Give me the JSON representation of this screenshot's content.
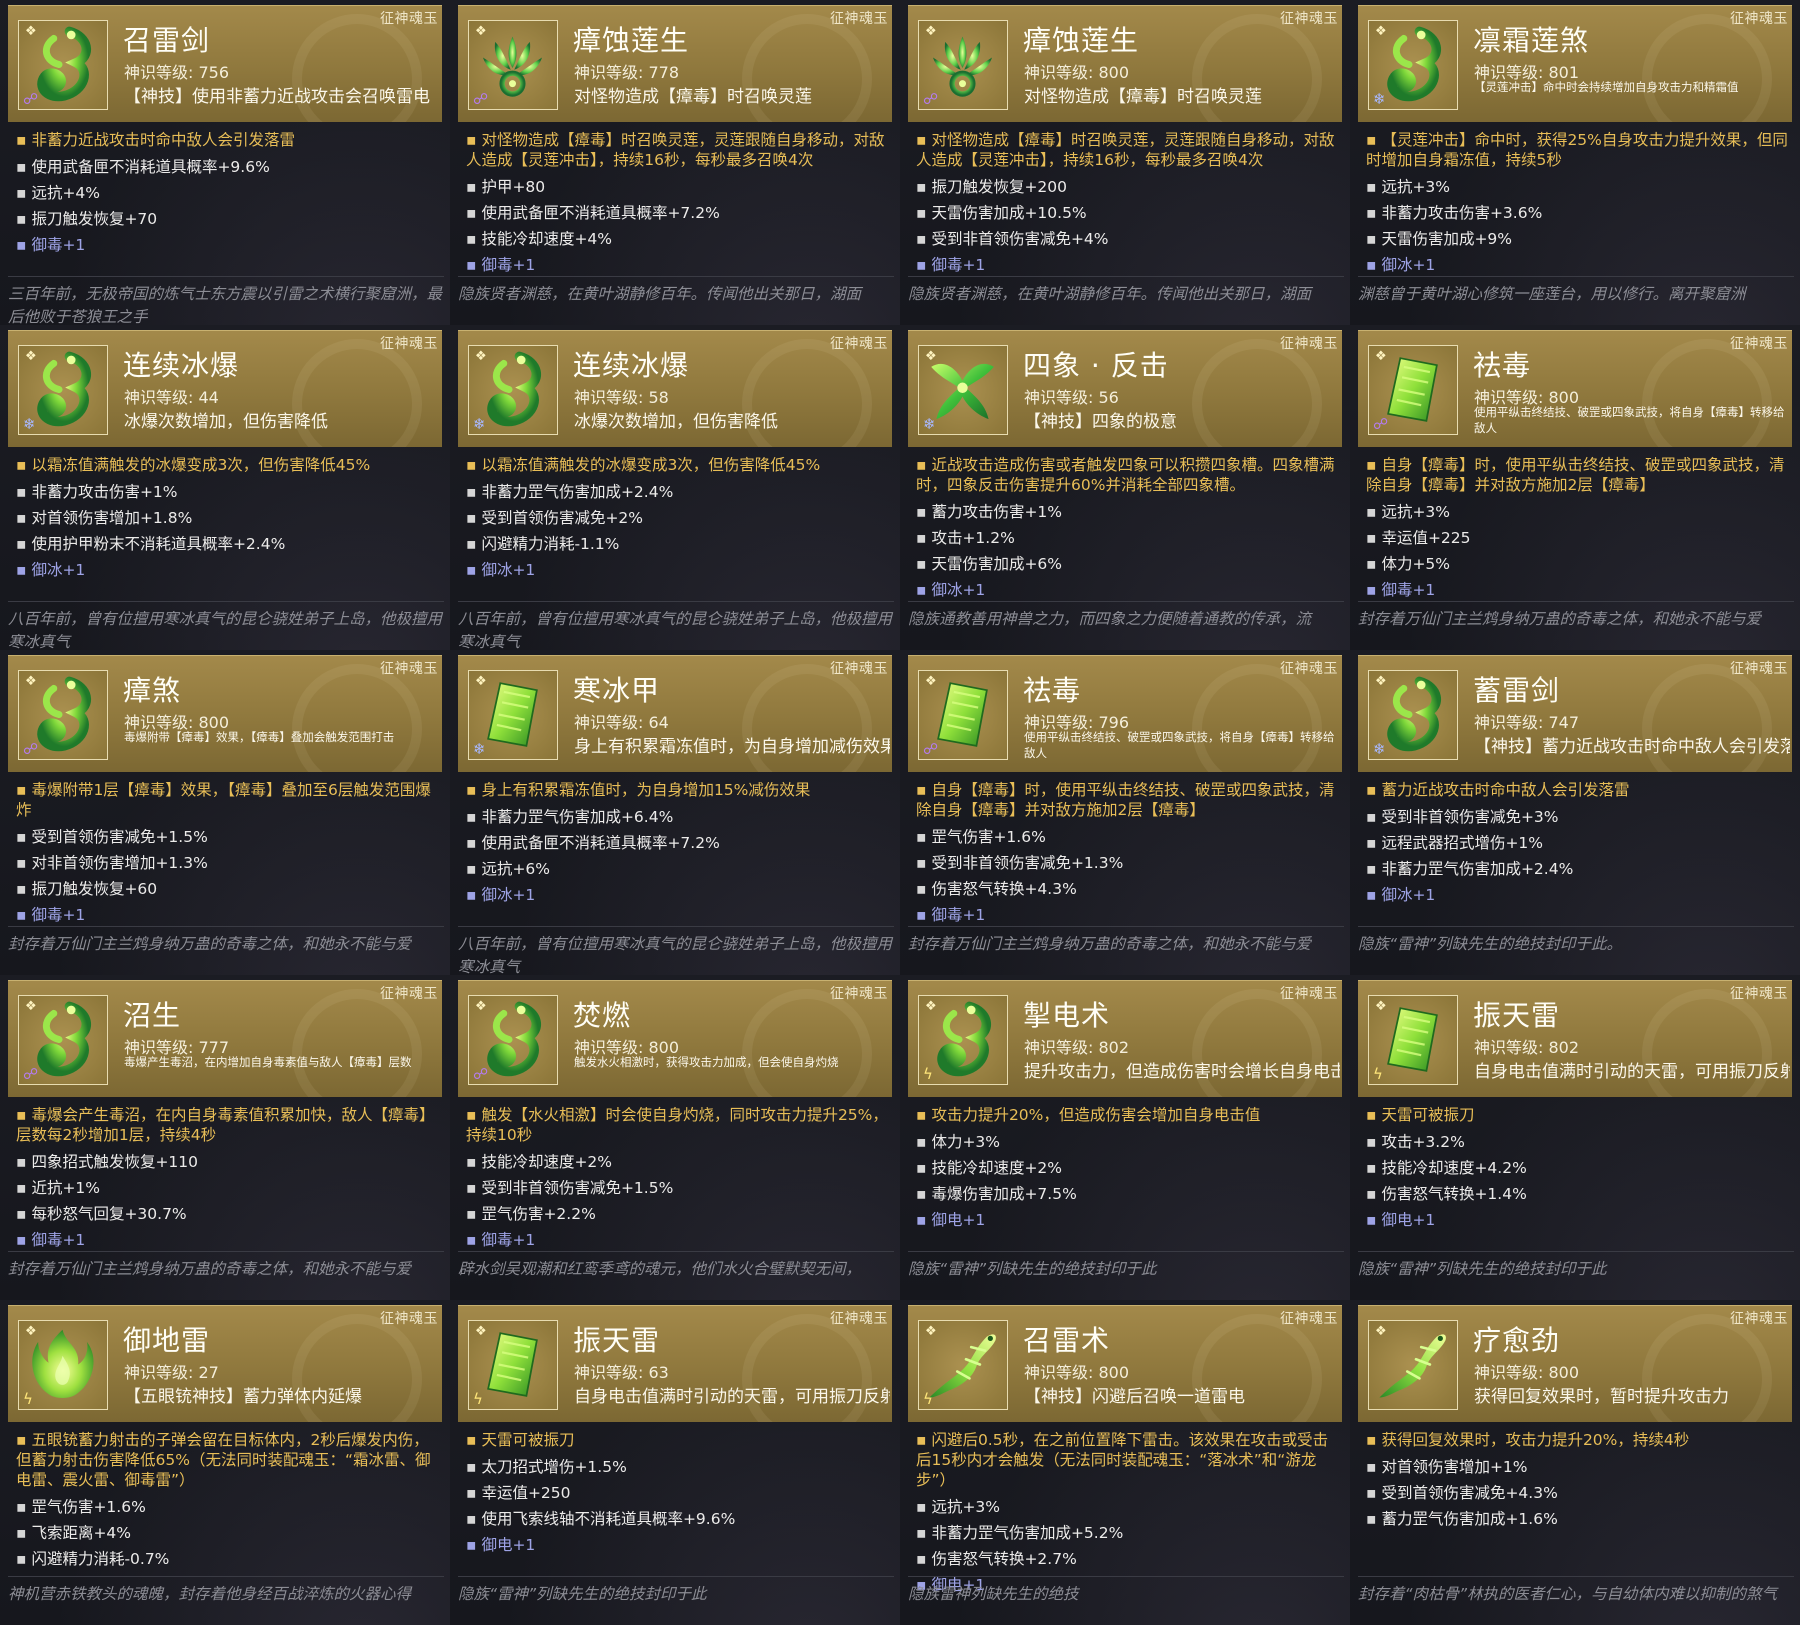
{
  "cards": [
    {
      "tag": "征神魂玉",
      "title": "召雷剑",
      "level": "神识等级: 756",
      "desc": "【神技】使用非蓄力近战攻击会召唤雷电",
      "desc_small": false,
      "icon": "serpent-jade-icon",
      "elem": "poison-icon",
      "effect": "非蓄力近战攻击时命中敌人会引发落雷",
      "stats": [
        "使用武备匣不消耗道具概率+9.6%",
        "远抗+4%",
        "振刀触发恢复+70"
      ],
      "resist": "御毒+1",
      "lore": "三百年前，无极帝国的炼气士东方震以引雷之术横行聚窟洲，最后他败于苍狼王之手"
    },
    {
      "tag": "征神魂玉",
      "title": "瘴蚀莲生",
      "level": "神识等级: 778",
      "desc": "对怪物造成【瘴毒】时召唤灵莲",
      "desc_small": false,
      "icon": "lotus-jade-icon",
      "elem": "poison-icon",
      "effect": "对怪物造成【瘴毒】时召唤灵莲，灵莲跟随自身移动，对敌人造成【灵莲冲击】，持续16秒，每秒最多召唤4次",
      "stats": [
        "护甲+80",
        "使用武备匣不消耗道具概率+7.2%",
        "技能冷却速度+4%"
      ],
      "resist": "御毒+1",
      "lore": "隐族贤者渊慈，在黄叶湖静修百年。传闻他出关那日，湖面"
    },
    {
      "tag": "征神魂玉",
      "title": "瘴蚀莲生",
      "level": "神识等级: 800",
      "desc": "对怪物造成【瘴毒】时召唤灵莲",
      "desc_small": false,
      "icon": "lotus-jade-icon",
      "elem": "poison-icon",
      "effect": "对怪物造成【瘴毒】时召唤灵莲，灵莲跟随自身移动，对敌人造成【灵莲冲击】，持续16秒，每秒最多召唤4次",
      "stats": [
        "振刀触发恢复+200",
        "天雷伤害加成+10.5%",
        "受到非首领伤害减免+4%"
      ],
      "resist": "御毒+1",
      "lore": "隐族贤者渊慈，在黄叶湖静修百年。传闻他出关那日，湖面"
    },
    {
      "tag": "征神魂玉",
      "title": "凛霜莲煞",
      "level": "神识等级: 801",
      "desc": "【灵莲冲击】命中时会持续增加自身攻击力和精霜值",
      "desc_small": true,
      "icon": "serpent-jade-icon",
      "elem": "ice-icon",
      "effect": "【灵莲冲击】命中时，获得25%自身攻击力提升效果，但同时增加自身霜冻值，持续5秒",
      "stats": [
        "远抗+3%",
        "非蓄力攻击伤害+3.6%",
        "天雷伤害加成+9%"
      ],
      "resist": "御冰+1",
      "lore": "渊慈曾于黄叶湖心修筑一座莲台，用以修行。离开聚窟洲"
    },
    {
      "tag": "征神魂玉",
      "title": "连续冰爆",
      "level": "神识等级: 44",
      "desc": "冰爆次数增加，但伤害降低",
      "desc_small": false,
      "icon": "serpent-jade-icon",
      "elem": "ice-icon",
      "effect": "以霜冻值满触发的冰爆变成3次，但伤害降低45%",
      "stats": [
        "非蓄力攻击伤害+1%",
        "对首领伤害增加+1.8%",
        "使用护甲粉末不消耗道具概率+2.4%"
      ],
      "resist": "御冰+1",
      "lore": "八百年前，曾有位擅用寒冰真气的昆仑骁姓弟子上岛，他极擅用寒冰真气"
    },
    {
      "tag": "征神魂玉",
      "title": "连续冰爆",
      "level": "神识等级: 58",
      "desc": "冰爆次数增加，但伤害降低",
      "desc_small": false,
      "icon": "serpent-jade-icon",
      "elem": "ice-icon",
      "effect": "以霜冻值满触发的冰爆变成3次，但伤害降低45%",
      "stats": [
        "非蓄力罡气伤害加成+2.4%",
        "受到首领伤害减免+2%",
        "闪避精力消耗-1.1%"
      ],
      "resist": "御冰+1",
      "lore": "八百年前，曾有位擅用寒冰真气的昆仑骁姓弟子上岛，他极擅用寒冰真气"
    },
    {
      "tag": "征神魂玉",
      "title": "四象 · 反击",
      "level": "神识等级: 56",
      "desc": "【神技】四象的极意",
      "desc_small": false,
      "icon": "ribbon-jade-icon",
      "elem": "ice-icon",
      "effect": "近战攻击造成伤害或者触发四象可以积攒四象槽。四象槽满时，四象反击伤害提升60%并消耗全部四象槽。",
      "stats": [
        "蓄力攻击伤害+1%",
        "攻击+1.2%",
        "天雷伤害加成+6%"
      ],
      "resist": "御冰+1",
      "lore": "隐族通教善用神兽之力，而四象之力便随着通教的传承，流"
    },
    {
      "tag": "征神魂玉",
      "title": "祛毒",
      "level": "神识等级: 800",
      "desc": "使用平纵击终结技、破罡或四象武技，将自身【瘴毒】转移给敌人",
      "desc_small": true,
      "icon": "slab-jade-icon",
      "elem": "poison-icon",
      "effect": "自身【瘴毒】时，使用平纵击终结技、破罡或四象武技，清除自身【瘴毒】并对敌方施加2层【瘴毒】",
      "stats": [
        "远抗+3%",
        "幸运值+225",
        "体力+5%"
      ],
      "resist": "御毒+1",
      "lore": "封存着万仙门主兰鸩身纳万蛊的奇毒之体，和她永不能与爱"
    },
    {
      "tag": "征神魂玉",
      "title": "瘴煞",
      "level": "神识等级: 800",
      "desc": "毒爆附带【瘴毒】效果，【瘴毒】叠加会触发范围打击",
      "desc_small": true,
      "icon": "serpent-jade-icon",
      "elem": "poison-icon",
      "effect": "毒爆附带1层【瘴毒】效果，【瘴毒】叠加至6层触发范围爆炸",
      "stats": [
        "受到首领伤害减免+1.5%",
        "对非首领伤害增加+1.3%",
        "振刀触发恢复+60"
      ],
      "resist": "御毒+1",
      "lore": "封存着万仙门主兰鸩身纳万蛊的奇毒之体，和她永不能与爱"
    },
    {
      "tag": "征神魂玉",
      "title": "寒冰甲",
      "level": "神识等级: 64",
      "desc": "身上有积累霜冻值时，为自身增加减伤效果",
      "desc_small": false,
      "icon": "slab-jade-icon",
      "elem": "ice-icon",
      "effect": "身上有积累霜冻值时，为自身增加15%减伤效果",
      "stats": [
        "非蓄力罡气伤害加成+6.4%",
        "使用武备匣不消耗道具概率+7.2%",
        "远抗+6%"
      ],
      "resist": "御冰+1",
      "lore": "八百年前，曾有位擅用寒冰真气的昆仑骁姓弟子上岛，他极擅用寒冰真气"
    },
    {
      "tag": "征神魂玉",
      "title": "祛毒",
      "level": "神识等级: 796",
      "desc": "使用平纵击终结技、破罡或四象武技，将自身【瘴毒】转移给敌人",
      "desc_small": true,
      "icon": "slab-jade-icon",
      "elem": "poison-icon",
      "effect": "自身【瘴毒】时，使用平纵击终结技、破罡或四象武技，清除自身【瘴毒】并对敌方施加2层【瘴毒】",
      "stats": [
        "罡气伤害+1.6%",
        "受到非首领伤害减免+1.3%",
        "伤害怒气转换+4.3%"
      ],
      "resist": "御毒+1",
      "lore": "封存着万仙门主兰鸩身纳万蛊的奇毒之体，和她永不能与爱"
    },
    {
      "tag": "征神魂玉",
      "title": "蓄雷剑",
      "level": "神识等级: 747",
      "desc": "【神技】蓄力近战攻击时命中敌人会引发落雷",
      "desc_small": false,
      "icon": "serpent-jade-icon",
      "elem": "ice-icon",
      "effect": "蓄力近战攻击时命中敌人会引发落雷",
      "stats": [
        "受到非首领伤害减免+3%",
        "远程武器招式增伤+1%",
        "非蓄力罡气伤害加成+2.4%"
      ],
      "resist": "御冰+1",
      "lore": "隐族“雷神”列缺先生的绝技封印于此。"
    },
    {
      "tag": "征神魂玉",
      "title": "沼生",
      "level": "神识等级: 777",
      "desc": "毒爆产生毒沼，在内增加自身毒素值与敌人【瘴毒】层数",
      "desc_small": true,
      "icon": "serpent-jade-icon",
      "elem": "poison-icon",
      "effect": "毒爆会产生毒沼，在内自身毒素值积累加快，敌人【瘴毒】层数每2秒增加1层，持续4秒",
      "stats": [
        "四象招式触发恢复+110",
        "近抗+1%",
        "每秒怒气回复+30.7%"
      ],
      "resist": "御毒+1",
      "lore": "封存着万仙门主兰鸩身纳万蛊的奇毒之体，和她永不能与爱"
    },
    {
      "tag": "征神魂玉",
      "title": "焚燃",
      "level": "神识等级: 800",
      "desc": "触发水火相激时，获得攻击力加成，但会使自身灼烧",
      "desc_small": true,
      "icon": "serpent-jade-icon",
      "elem": "poison-icon",
      "effect": "触发【水火相激】时会使自身灼烧，同时攻击力提升25%，持续10秒",
      "stats": [
        "技能冷却速度+2%",
        "受到非首领伤害减免+1.5%",
        "罡气伤害+2.2%"
      ],
      "resist": "御毒+1",
      "lore": "辟水剑吴观潮和红鸾季鸢的魂元，他们水火合璧默契无间，"
    },
    {
      "tag": "征神魂玉",
      "title": "掣电术",
      "level": "神识等级: 802",
      "desc": "提升攻击力，但造成伤害时会增长自身电击值",
      "desc_small": false,
      "icon": "serpent-jade-icon",
      "elem": "thunder-icon",
      "effect": "攻击力提升20%，但造成伤害会增加自身电击值",
      "stats": [
        "体力+3%",
        "技能冷却速度+2%",
        "毒爆伤害加成+7.5%"
      ],
      "resist": "御电+1",
      "lore": "隐族“雷神”列缺先生的绝技封印于此"
    },
    {
      "tag": "征神魂玉",
      "title": "振天雷",
      "level": "神识等级: 802",
      "desc": "自身电击值满时引动的天雷，可用振刀反射出去",
      "desc_small": false,
      "icon": "slab-jade-icon",
      "elem": "thunder-icon",
      "effect": "天雷可被振刀",
      "stats": [
        "攻击+3.2%",
        "技能冷却速度+4.2%",
        "伤害怒气转换+1.4%"
      ],
      "resist": "御电+1",
      "lore": "隐族“雷神”列缺先生的绝技封印于此"
    },
    {
      "tag": "征神魂玉",
      "title": "御地雷",
      "level": "神识等级: 27",
      "desc": "【五眼铳神技】蓄力弹体内延爆",
      "desc_small": false,
      "icon": "flame-jade-icon",
      "elem": "thunder-icon",
      "effect": "五眼铳蓄力射击的子弹会留在目标体内，2秒后爆发内伤，但蓄力射击伤害降低65%（无法同时装配魂玉：“霜冰雷、御电雷、震火雷、御毒雷”）",
      "stats": [
        "罡气伤害+1.6%",
        "飞索距离+4%",
        "闪避精力消耗-0.7%"
      ],
      "resist": "",
      "lore": "神机营赤铁教头的魂魄，封存着他身经百战淬炼的火器心得"
    },
    {
      "tag": "征神魂玉",
      "title": "振天雷",
      "level": "神识等级: 63",
      "desc": "自身电击值满时引动的天雷，可用振刀反射出去",
      "desc_small": false,
      "icon": "slab-jade-icon",
      "elem": "thunder-icon",
      "effect": "天雷可被振刀",
      "stats": [
        "太刀招式增伤+1.5%",
        "幸运值+250",
        "使用飞索线轴不消耗道具概率+9.6%"
      ],
      "resist": "御电+1",
      "lore": "隐族“雷神”列缺先生的绝技封印于此"
    },
    {
      "tag": "征神魂玉",
      "title": "召雷术",
      "level": "神识等级: 800",
      "desc": "【神技】闪避后召唤一道雷电",
      "desc_small": false,
      "icon": "dragon-jade-icon",
      "elem": "thunder-icon",
      "effect": "闪避后0.5秒，在之前位置降下雷击。该效果在攻击或受击后15秒内才会触发（无法同时装配魂玉：“落冰术”和“游龙步”）",
      "stats": [
        "远抗+3%",
        "非蓄力罡气伤害加成+5.2%",
        "伤害怒气转换+2.7%"
      ],
      "resist": "御电+1",
      "lore": "隐族雷神列缺先生的绝技"
    },
    {
      "tag": "征神魂玉",
      "title": "疗愈劲",
      "level": "神识等级: 800",
      "desc": "获得回复效果时，暂时提升攻击力",
      "desc_small": false,
      "icon": "dragon-jade-icon",
      "elem": "",
      "effect": "获得回复效果时，攻击力提升20%，持续4秒",
      "stats": [
        "对首领伤害增加+1%",
        "受到首领伤害减免+4.3%",
        "蓄力罡气伤害加成+1.6%"
      ],
      "resist": "",
      "lore": "封存着“肉枯骨”林执的医者仁心，与自幼体内难以抑制的煞气"
    }
  ]
}
